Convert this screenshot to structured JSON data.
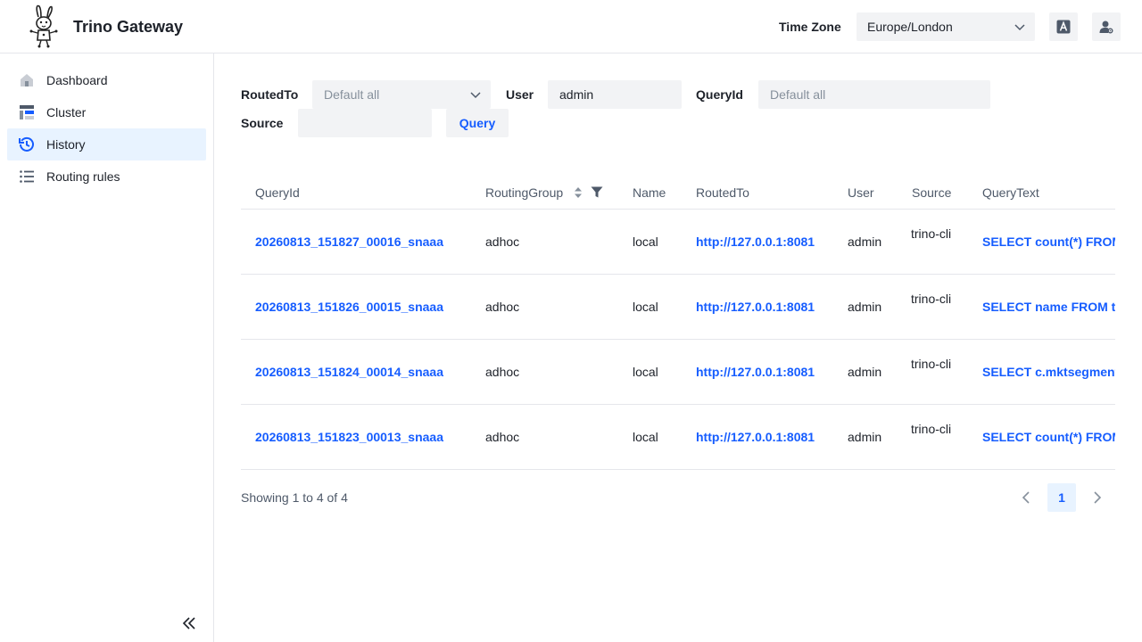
{
  "header": {
    "app_title": "Trino Gateway",
    "timezone_label": "Time Zone",
    "timezone_value": "Europe/London",
    "icons": [
      "language-icon",
      "user-settings-icon"
    ]
  },
  "sidebar": {
    "items": [
      {
        "label": "Dashboard",
        "icon": "home-icon",
        "active": false
      },
      {
        "label": "Cluster",
        "icon": "cluster-icon",
        "active": false
      },
      {
        "label": "History",
        "icon": "history-icon",
        "active": true
      },
      {
        "label": "Routing rules",
        "icon": "list-icon",
        "active": false
      }
    ],
    "collapse_icon": "double-chevron-left-icon"
  },
  "filters": {
    "routed_to": {
      "label": "RoutedTo",
      "placeholder": "Default all"
    },
    "user": {
      "label": "User",
      "value": "admin"
    },
    "query_id": {
      "label": "QueryId",
      "placeholder": "Default all"
    },
    "source": {
      "label": "Source",
      "value": ""
    },
    "query_button": "Query"
  },
  "table": {
    "columns": [
      "QueryId",
      "RoutingGroup",
      "Name",
      "RoutedTo",
      "User",
      "Source",
      "QueryText"
    ],
    "rows": [
      {
        "query_id": "20260813_151827_00016_snaaa",
        "routing_group": "adhoc",
        "name": "local",
        "routed_to": "http://127.0.0.1:8081",
        "user": "admin",
        "source": "trino-cli",
        "query_text": "SELECT count(*) FROM"
      },
      {
        "query_id": "20260813_151826_00015_snaaa",
        "routing_group": "adhoc",
        "name": "local",
        "routed_to": "http://127.0.0.1:8081",
        "user": "admin",
        "source": "trino-cli",
        "query_text": "SELECT name FROM tp"
      },
      {
        "query_id": "20260813_151824_00014_snaaa",
        "routing_group": "adhoc",
        "name": "local",
        "routed_to": "http://127.0.0.1:8081",
        "user": "admin",
        "source": "trino-cli",
        "query_text": "SELECT c.mktsegment"
      },
      {
        "query_id": "20260813_151823_00013_snaaa",
        "routing_group": "adhoc",
        "name": "local",
        "routed_to": "http://127.0.0.1:8081",
        "user": "admin",
        "source": "trino-cli",
        "query_text": "SELECT count(*) FROM"
      }
    ]
  },
  "pagination": {
    "showing": "Showing 1 to 4 of 4",
    "current_page": "1"
  },
  "colors": {
    "accent": "#165dff",
    "active_bg": "#e8f3ff",
    "input_bg": "#f2f3f5",
    "border": "#e5e6eb"
  }
}
